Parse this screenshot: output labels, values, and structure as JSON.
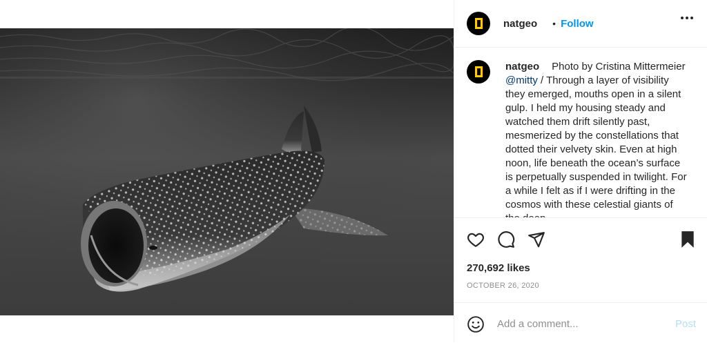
{
  "post": {
    "username": "natgeo",
    "follow_dot": "•",
    "follow_label": "Follow",
    "caption_prefix": "Photo by Cristina Mittermeier ",
    "caption_mention": "@mitty",
    "caption_text": " / Through a layer of visibility they emerged, mouths open in a silent gulp. I held my housing steady and watched them drift silently past, mesmerized by the constellations that dotted their velvety skin. Even at high noon, life beneath the ocean’s surface is perpetually suspended in twilight. For a while I felt as if I were drifting in the cosmos with these celestial giants of the deep.",
    "likes": "270,692 likes",
    "date": "OCTOBER 26, 2020"
  },
  "actions": {
    "icons": [
      "heart-icon",
      "comment-icon",
      "share-icon",
      "bookmark-icon"
    ]
  },
  "comment": {
    "placeholder": "Add a comment...",
    "post_label": "Post"
  },
  "colors": {
    "accent": "#0095f6",
    "post_disabled": "#b2dffc",
    "brand_yellow": "#ffcc00",
    "muted": "#8e8e8e"
  }
}
